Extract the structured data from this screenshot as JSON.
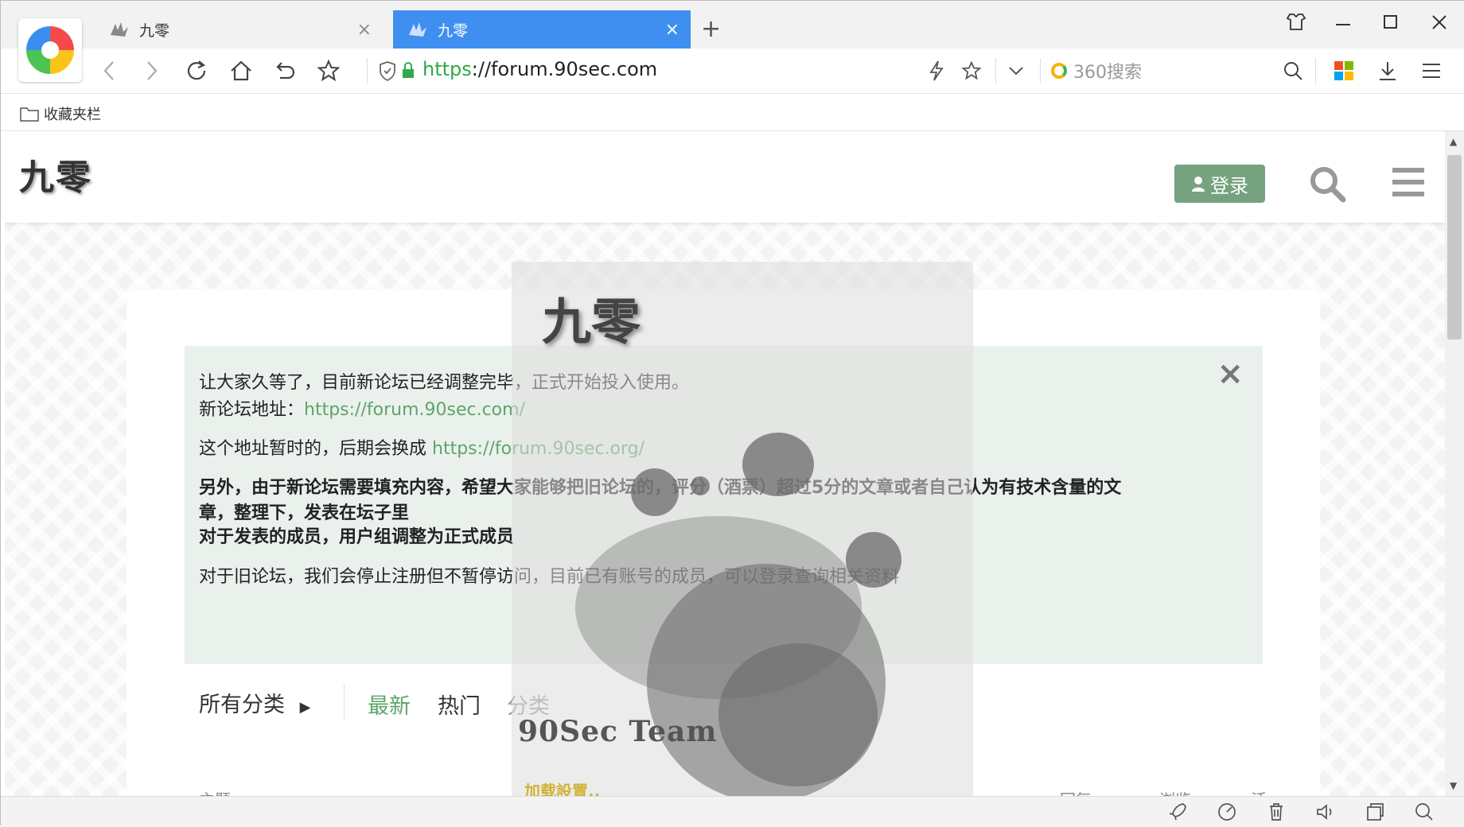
{
  "tabs": [
    {
      "title": "九零",
      "active": false
    },
    {
      "title": "九零",
      "active": true
    }
  ],
  "address_bar": {
    "scheme": "https",
    "rest": "://forum.90sec.com",
    "search_placeholder": "360搜索"
  },
  "bookmarks_bar": {
    "folder_label": "收藏夹栏"
  },
  "site": {
    "logo_text": "九零",
    "login_label": "登录"
  },
  "notice": {
    "line1": "让大家久等了，目前新论坛已经调整完毕，正式开始投入使用。",
    "line2_prefix": "新论坛地址：",
    "line2_link": "https://forum.90sec.com/",
    "line3_prefix": "这个地址暂时的，后期会换成 ",
    "line3_link": "https://forum.90sec.org/",
    "bold1": "另外，由于新论坛需要填充内容，希望大家能够把旧论坛的，评分（酒票）超过5分的文章或者自己认为有技术含量的文",
    "bold2": "章，整理下，发表在坛子里",
    "bold3": "对于发表的成员，用户组调整为正式成员",
    "line4": "对于旧论坛，我们会停止注册但不暂停访问，目前已有账号的成员，可以登录查询相关资料"
  },
  "category_nav": {
    "all_categories": "所有分类",
    "tabs": [
      "最新",
      "热门",
      "分类"
    ],
    "active_tab": "最新"
  },
  "topic_columns": {
    "topic": "主题",
    "replies": "回复",
    "views": "浏览",
    "activity": "活动"
  },
  "loader": {
    "logo_text": "九零",
    "team": "90Sec Team",
    "loading": "加载設置.."
  },
  "colors": {
    "active_tab": "#3f8ff0",
    "login_button": "#76a27f",
    "link_green": "#5fa46a",
    "notice_bg": "#eaf1ec",
    "loading_text": "#d2b233"
  }
}
